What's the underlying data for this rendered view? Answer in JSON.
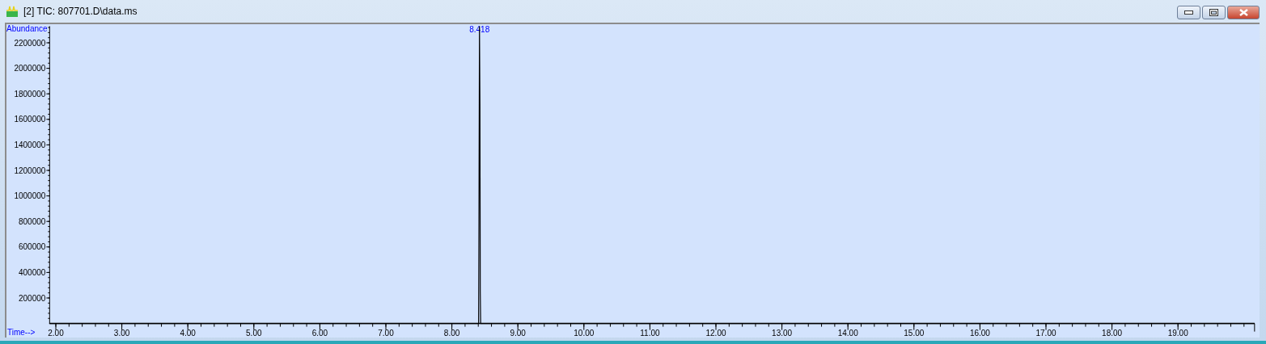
{
  "window": {
    "title": "[2] TIC: 807701.D\\data.ms"
  },
  "chart_data": {
    "type": "line",
    "xlabel": "Time-->",
    "ylabel": "Abundance",
    "xlim": [
      1.9,
      20.16
    ],
    "ylim": [
      0,
      2330000
    ],
    "x": [
      1.9,
      8.38,
      8.405,
      8.41,
      8.418,
      8.425,
      8.43,
      8.436,
      8.445,
      20.16
    ],
    "series": [
      {
        "color": "#000000",
        "values": [
          0,
          0,
          0,
          800000,
          2330000,
          1720000,
          250000,
          0,
          0,
          0
        ]
      }
    ],
    "xticks": [
      {
        "value": 2,
        "label": "2.00"
      },
      {
        "value": 3,
        "label": "3.00"
      },
      {
        "value": 4,
        "label": "4.00"
      },
      {
        "value": 5,
        "label": "5.00"
      },
      {
        "value": 6,
        "label": "6.00"
      },
      {
        "value": 7,
        "label": "7.00"
      },
      {
        "value": 8,
        "label": "8.00"
      },
      {
        "value": 9,
        "label": "9.00"
      },
      {
        "value": 10,
        "label": "10.00"
      },
      {
        "value": 11,
        "label": "11.00"
      },
      {
        "value": 12,
        "label": "12.00"
      },
      {
        "value": 13,
        "label": "13.00"
      },
      {
        "value": 14,
        "label": "14.00"
      },
      {
        "value": 15,
        "label": "15.00"
      },
      {
        "value": 16,
        "label": "16.00"
      },
      {
        "value": 17,
        "label": "17.00"
      },
      {
        "value": 18,
        "label": "18.00"
      },
      {
        "value": 19,
        "label": "19.00"
      }
    ],
    "yticks": [
      {
        "value": 200000,
        "label": "200000"
      },
      {
        "value": 400000,
        "label": "400000"
      },
      {
        "value": 600000,
        "label": "600000"
      },
      {
        "value": 800000,
        "label": "800000"
      },
      {
        "value": 1000000,
        "label": "1000000"
      },
      {
        "value": 1200000,
        "label": "1200000"
      },
      {
        "value": 1400000,
        "label": "1400000"
      },
      {
        "value": 1600000,
        "label": "1600000"
      },
      {
        "value": 1800000,
        "label": "1800000"
      },
      {
        "value": 2000000,
        "label": "2000000"
      },
      {
        "value": 2200000,
        "label": "2200000"
      }
    ],
    "annotations": [
      {
        "x": 8.418,
        "text": "8.418"
      }
    ]
  }
}
